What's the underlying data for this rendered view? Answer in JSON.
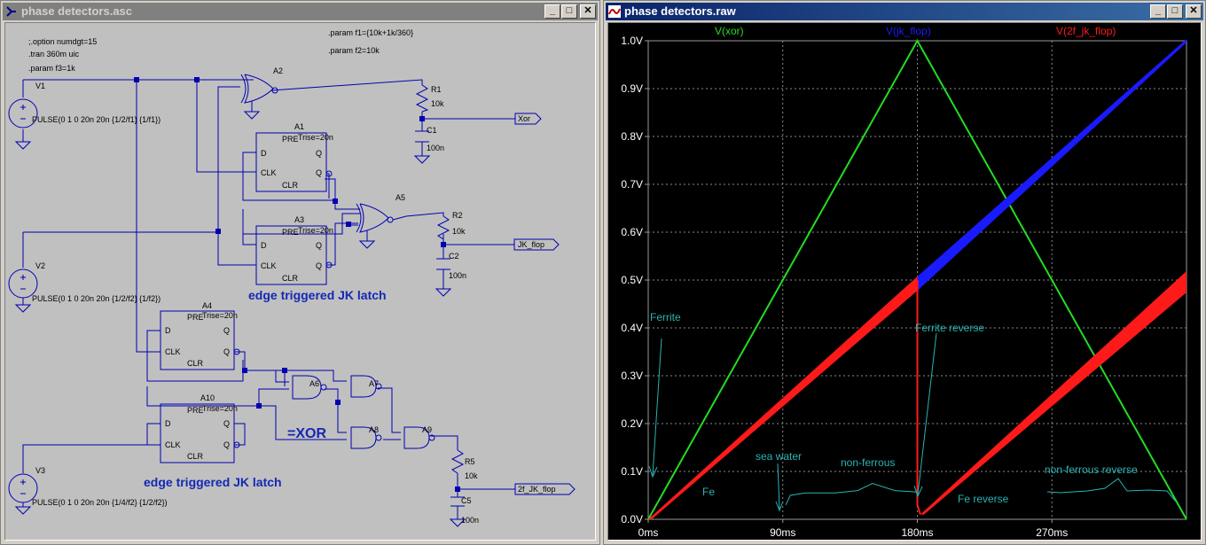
{
  "left_window": {
    "title": "phase detectors.asc",
    "buttons": [
      "minimize",
      "maximize",
      "close"
    ],
    "directives": {
      "options": ";.option numdgt=15",
      "tran": ".tran 360m uic",
      "param_f3": ".param f3=1k",
      "param_f1": ".param f1={10k+1k/360}",
      "param_f2": ".param f2=10k"
    },
    "sources": [
      {
        "name": "V1",
        "value": "PULSE(0 1 0 20n 20n {1/2/f1} {1/f1})"
      },
      {
        "name": "V2",
        "value": "PULSE(0 1 0 20n 20n {1/2/f2} {1/f2})"
      },
      {
        "name": "V3",
        "value": "PULSE(0 1 0 20n 20n {1/4/f2} {1/2/f2})"
      }
    ],
    "gates": {
      "a2": "A2",
      "a5": "A5",
      "a6": "A6",
      "a7": "A7",
      "a8": "A8",
      "a9": "A9"
    },
    "flops": [
      {
        "name": "A1",
        "trise": "Trise=20n"
      },
      {
        "name": "A3",
        "trise": "Trise=20n"
      },
      {
        "name": "A4",
        "trise": "Trise=20n"
      },
      {
        "name": "A10",
        "trise": "Trise=20n"
      }
    ],
    "pins": {
      "pre": "PRE",
      "d": "D",
      "clk": "CLK",
      "clr": "CLR",
      "q": "Q",
      "qbar": "Q"
    },
    "resistors": [
      {
        "name": "R1",
        "value": "10k"
      },
      {
        "name": "R2",
        "value": "10k"
      },
      {
        "name": "R5",
        "value": "10k"
      }
    ],
    "capacitors": [
      {
        "name": "C1",
        "value": "100n"
      },
      {
        "name": "C2",
        "value": "100n"
      },
      {
        "name": "C5",
        "value": "100n"
      }
    ],
    "net_labels": [
      "Xor",
      "JK_flop",
      "2f_JK_flop"
    ],
    "comments": {
      "jk1": "edge triggered JK latch",
      "xor": "=XOR",
      "jk2": "edge triggered JK latch"
    }
  },
  "right_window": {
    "title": "phase detectors.raw",
    "buttons": [
      "minimize",
      "maximize",
      "close"
    ],
    "legend": [
      {
        "name": "V(xor)",
        "color": "#22dd22"
      },
      {
        "name": "V(jk_flop)",
        "color": "#1a1aff"
      },
      {
        "name": "V(2f_jk_flop)",
        "color": "#ff1a1a"
      }
    ],
    "annotations": {
      "ferrite": "Ferrite",
      "fe": "Fe",
      "sea_water": "sea water",
      "non_ferrous": "non-ferrous",
      "ferrite_reverse": "Ferrite reverse",
      "fe_reverse": "Fe reverse",
      "non_ferrous_reverse": "non-ferrous reverse"
    }
  },
  "chart_data": {
    "type": "line",
    "xlabel": "",
    "ylabel": "",
    "xlim": [
      0,
      360
    ],
    "ylim": [
      0,
      1.0
    ],
    "x_ticks": [
      "0ms",
      "90ms",
      "180ms",
      "270ms"
    ],
    "y_ticks": [
      "0.0V",
      "0.1V",
      "0.2V",
      "0.3V",
      "0.4V",
      "0.5V",
      "0.6V",
      "0.7V",
      "0.8V",
      "0.9V",
      "1.0V"
    ],
    "grid": true,
    "legend_position": "top",
    "series": [
      {
        "name": "V(xor)",
        "color": "#22dd22",
        "x": [
          0,
          180,
          360
        ],
        "y": [
          0,
          1.0,
          0
        ]
      },
      {
        "name": "V(jk_flop)",
        "color": "#1a1aff",
        "x": [
          180,
          360
        ],
        "y": [
          0.5,
          1.0
        ]
      },
      {
        "name": "V(2f_jk_flop)",
        "color": "#ff1a1a",
        "x": [
          0,
          180,
          180,
          182,
          360
        ],
        "y": [
          0,
          0.5,
          0.03,
          0.01,
          0.5
        ]
      }
    ],
    "trace_annotation_values": {
      "sea_water_trace_x": [
        92,
        95,
        105,
        125,
        140,
        150,
        165,
        180
      ],
      "sea_water_trace_y": [
        0.03,
        0.05,
        0.055,
        0.055,
        0.06,
        0.075,
        0.06,
        0.057
      ]
    }
  }
}
